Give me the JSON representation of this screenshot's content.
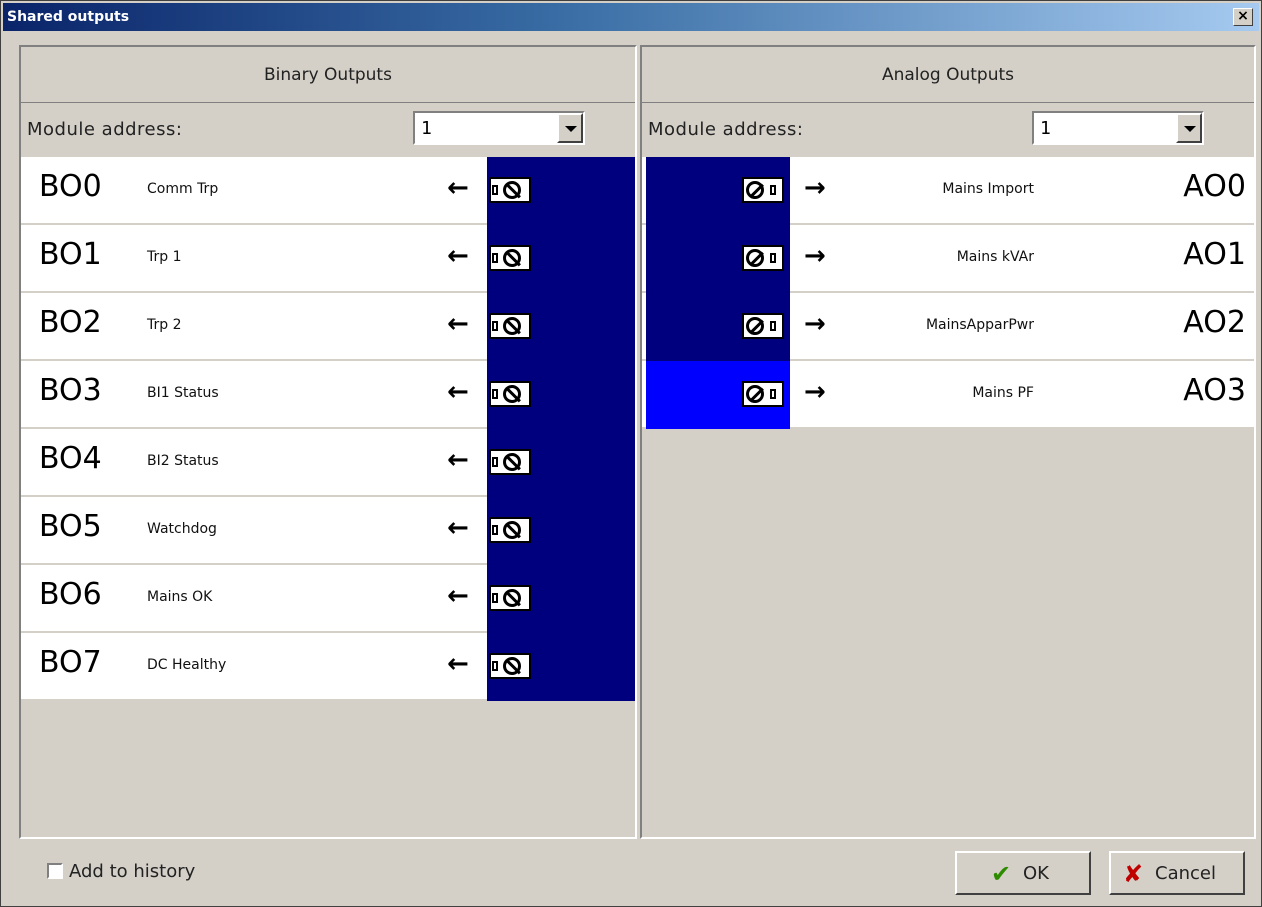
{
  "window": {
    "title": "Shared outputs",
    "close_glyph": "×"
  },
  "binary": {
    "header": "Binary Outputs",
    "address_label": "Module address:",
    "address_value": "1",
    "items": [
      {
        "code": "BO0",
        "name": "Comm Trp"
      },
      {
        "code": "BO1",
        "name": "Trp 1"
      },
      {
        "code": "BO2",
        "name": "Trp 2"
      },
      {
        "code": "BO3",
        "name": "BI1 Status"
      },
      {
        "code": "BO4",
        "name": "BI2 Status"
      },
      {
        "code": "BO5",
        "name": "Watchdog"
      },
      {
        "code": "BO6",
        "name": "Mains OK"
      },
      {
        "code": "BO7",
        "name": "DC Healthy"
      }
    ]
  },
  "analog": {
    "header": "Analog Outputs",
    "address_label": "Module address:",
    "address_value": "1",
    "items": [
      {
        "code": "AO0",
        "name": "Mains Import",
        "level": 1.0
      },
      {
        "code": "AO1",
        "name": "Mains kVAr",
        "level": 1.0
      },
      {
        "code": "AO2",
        "name": "MainsApparPwr",
        "level": 1.0
      },
      {
        "code": "AO3",
        "name": "Mains PF",
        "level": 1.0
      }
    ]
  },
  "colors": {
    "active_fill": "#00007f",
    "highlight_fill": "#0000ff"
  },
  "footer": {
    "history_label": "Add to history",
    "history_checked": false,
    "ok_label": "OK",
    "cancel_label": "Cancel"
  }
}
